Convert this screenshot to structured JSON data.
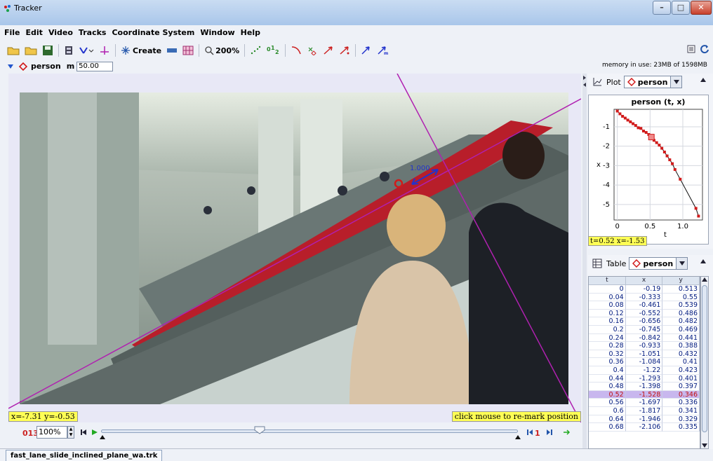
{
  "window": {
    "title": "Tracker"
  },
  "menu": [
    "File",
    "Edit",
    "Video",
    "Tracks",
    "Coordinate System",
    "Window",
    "Help"
  ],
  "toolbar": {
    "create_label": "Create",
    "zoom_label": "200%"
  },
  "trackbar": {
    "track_name": "person",
    "mass_label": "m",
    "mass_value": "50.00",
    "memory": "memory in use: 23MB of 1598MB"
  },
  "video": {
    "coord_readout": "x=-7.31  y=-0.53",
    "hint": "click mouse to re-mark position",
    "calibration_label": "1.000"
  },
  "player": {
    "frame": "013",
    "zoom": "100%",
    "step": "1"
  },
  "file_tab": "fast_lane_slide_inclined_plane_wa.trk",
  "plot": {
    "panel_label": "Plot",
    "track": "person",
    "readout": "t=0.52  x=-1.53"
  },
  "table": {
    "panel_label": "Table",
    "track": "person",
    "columns": [
      "t",
      "x",
      "y"
    ],
    "selected_index": 13,
    "rows": [
      [
        "0",
        "-0.19",
        "0.513"
      ],
      [
        "0.04",
        "-0.333",
        "0.55"
      ],
      [
        "0.08",
        "-0.461",
        "0.539"
      ],
      [
        "0.12",
        "-0.552",
        "0.486"
      ],
      [
        "0.16",
        "-0.656",
        "0.482"
      ],
      [
        "0.2",
        "-0.745",
        "0.469"
      ],
      [
        "0.24",
        "-0.842",
        "0.441"
      ],
      [
        "0.28",
        "-0.933",
        "0.388"
      ],
      [
        "0.32",
        "-1.051",
        "0.432"
      ],
      [
        "0.36",
        "-1.084",
        "0.41"
      ],
      [
        "0.4",
        "-1.22",
        "0.423"
      ],
      [
        "0.44",
        "-1.293",
        "0.401"
      ],
      [
        "0.48",
        "-1.398",
        "0.397"
      ],
      [
        "0.52",
        "-1.528",
        "0.346"
      ],
      [
        "0.56",
        "-1.697",
        "0.336"
      ],
      [
        "0.6",
        "-1.817",
        "0.341"
      ],
      [
        "0.64",
        "-1.946",
        "0.329"
      ],
      [
        "0.68",
        "-2.106",
        "0.335"
      ]
    ]
  },
  "chart_data": {
    "type": "line",
    "title": "person (t, x)",
    "xlabel": "t",
    "ylabel": "x",
    "xlim": [
      -0.05,
      1.3
    ],
    "ylim": [
      -5.8,
      -0.1
    ],
    "xticks": [
      0,
      0.5,
      1.0
    ],
    "xtick_labels": [
      "0",
      "0.5",
      "1.0"
    ],
    "yticks": [
      -1,
      -2,
      -3,
      -4,
      -5
    ],
    "selected_point": [
      0.52,
      -1.53
    ],
    "series": [
      {
        "x": [
          0,
          0.04,
          0.08,
          0.12,
          0.16,
          0.2,
          0.24,
          0.28,
          0.32,
          0.36,
          0.4,
          0.44,
          0.48,
          0.52,
          0.56,
          0.6,
          0.64,
          0.68,
          0.72,
          0.76,
          0.8,
          0.84,
          0.88,
          0.96,
          1.2,
          1.24
        ],
        "y": [
          -0.19,
          -0.333,
          -0.461,
          -0.552,
          -0.656,
          -0.745,
          -0.842,
          -0.933,
          -1.051,
          -1.084,
          -1.22,
          -1.293,
          -1.398,
          -1.528,
          -1.697,
          -1.817,
          -1.946,
          -2.106,
          -2.3,
          -2.5,
          -2.7,
          -2.9,
          -3.2,
          -3.7,
          -5.2,
          -5.6
        ]
      }
    ]
  },
  "colors": {
    "track_marker": "#d11a1a",
    "calibration": "#2233cc",
    "axis_line": "#b020b0",
    "highlight": "#ffff55"
  }
}
